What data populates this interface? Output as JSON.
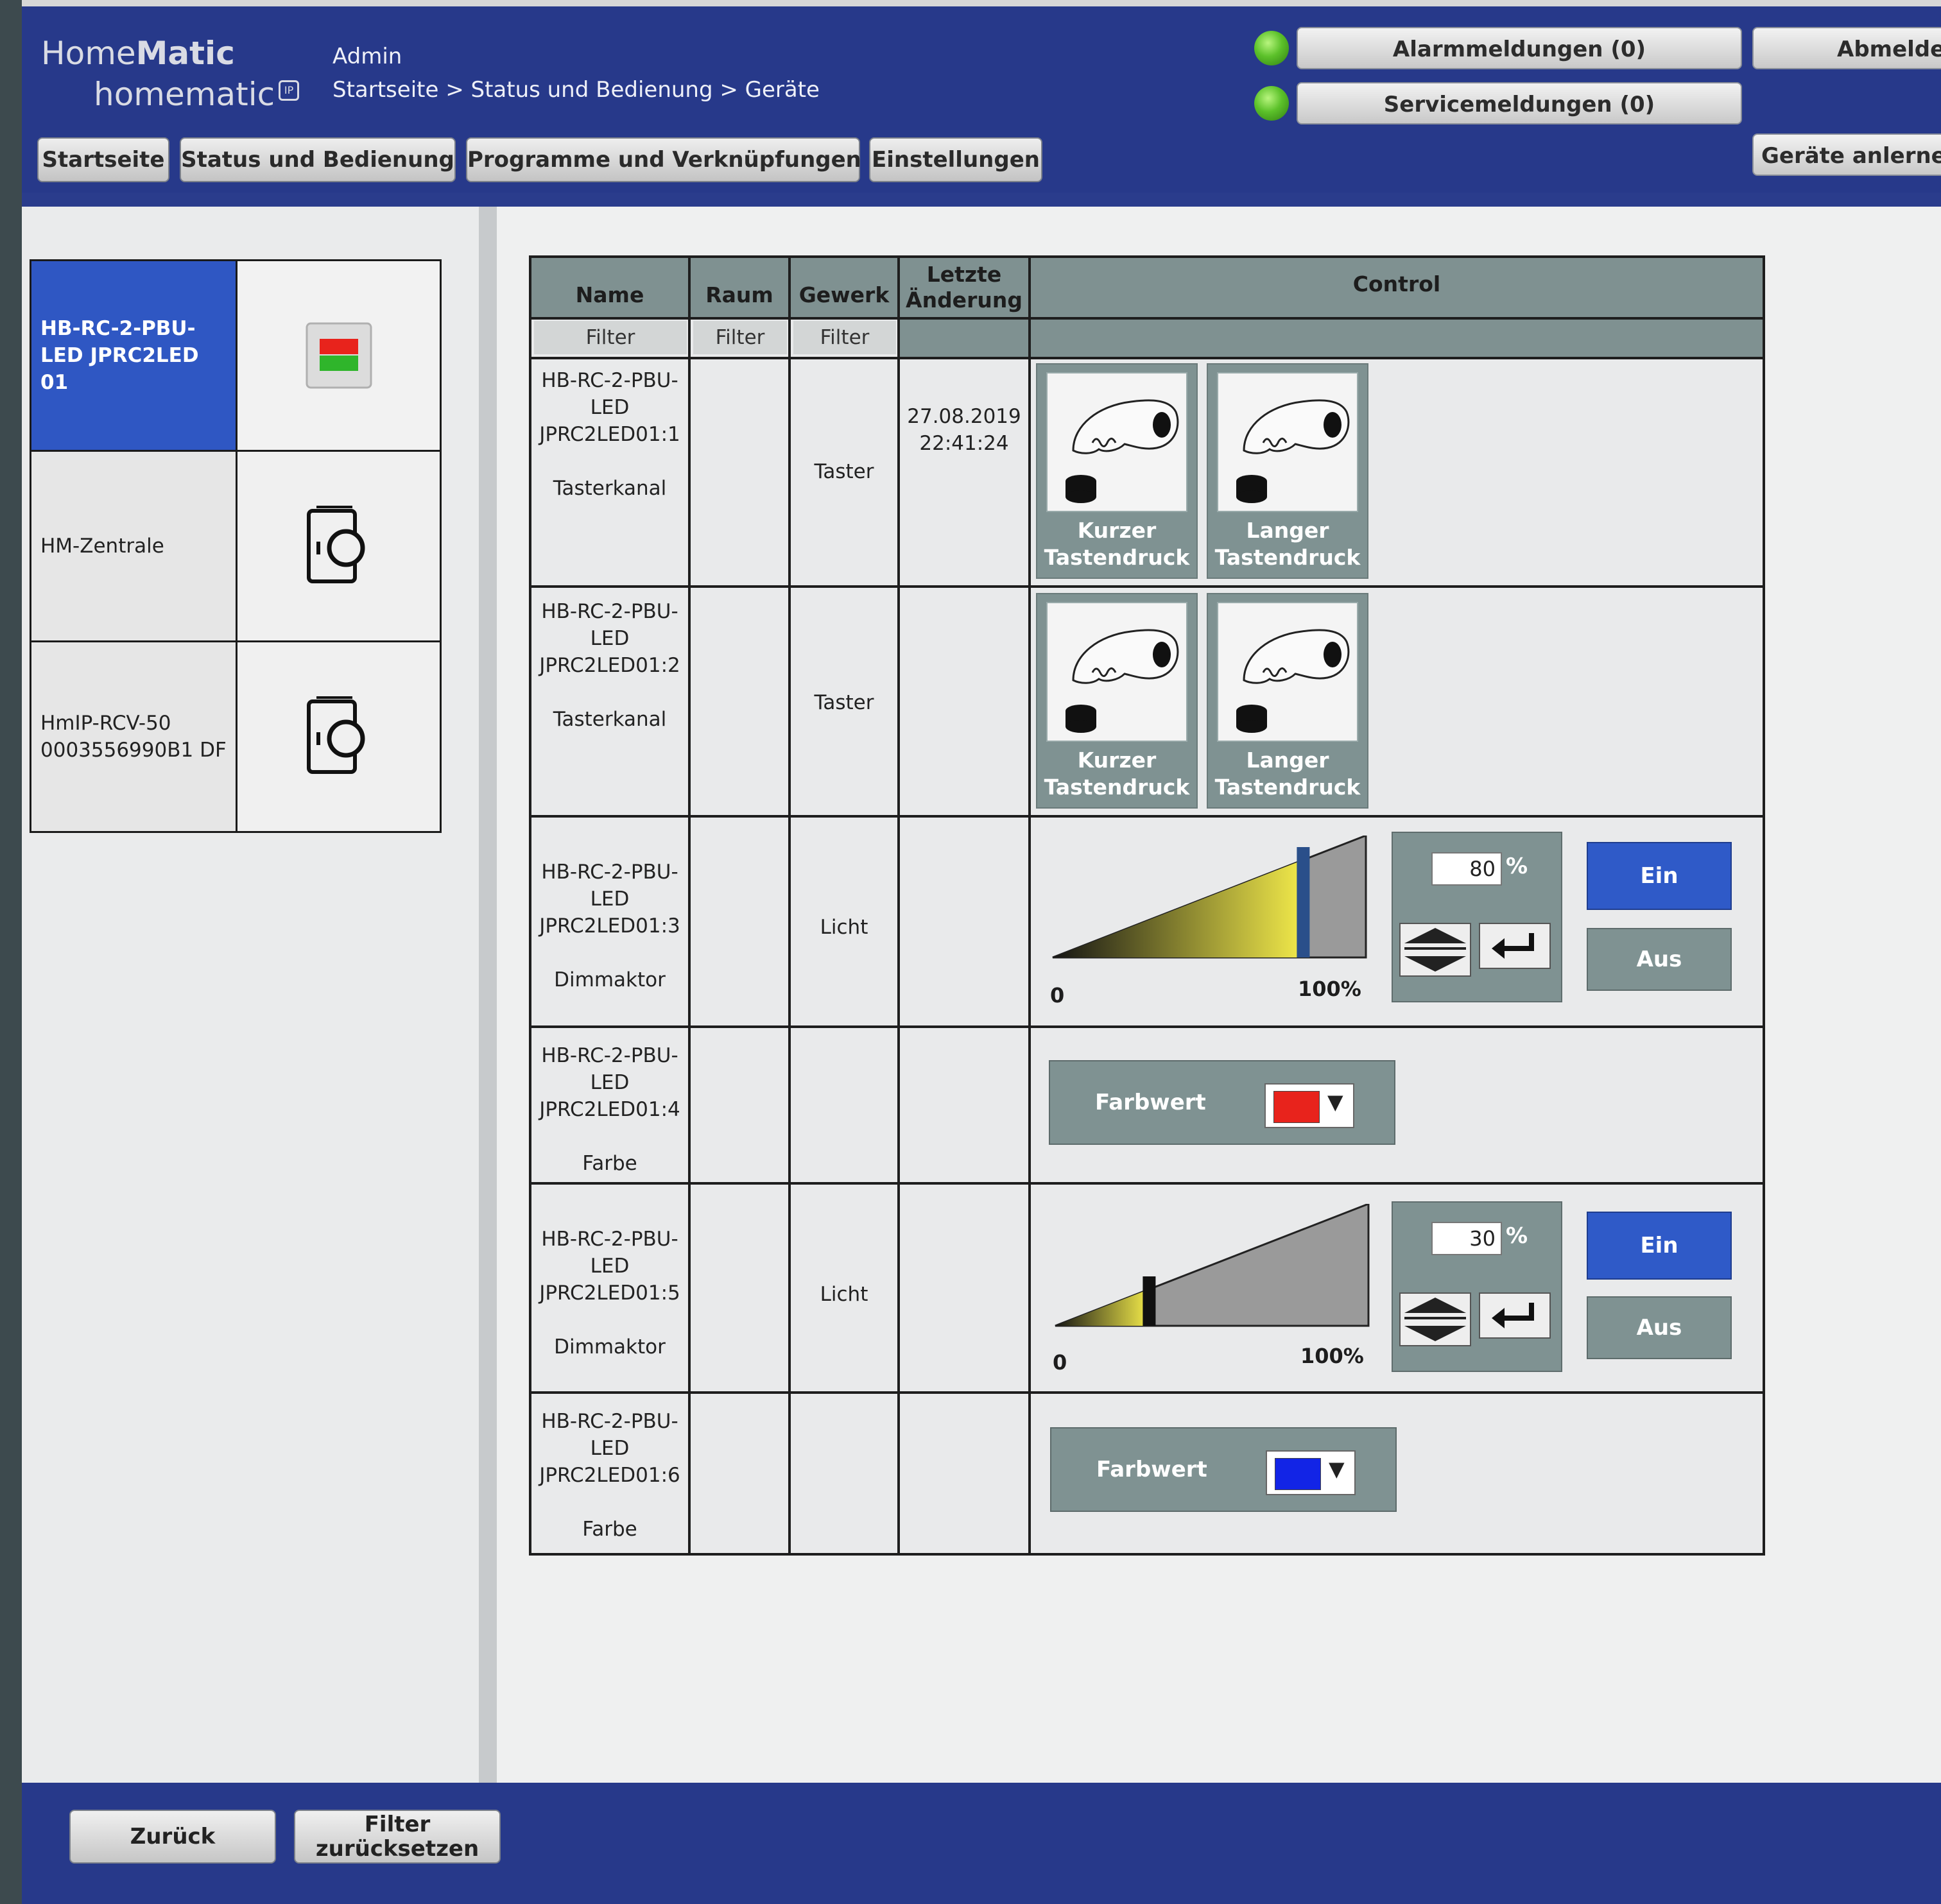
{
  "header": {
    "logo_line1_a": "Home",
    "logo_line1_b": "Matic",
    "logo_line2": "homematic",
    "logo_reg": "IP",
    "user": "Admin",
    "breadcrumb": "Startseite > Status und Bedienung > Geräte",
    "alarm_button": "Alarmmeldungen (0)",
    "service_button": "Servicemeldungen (0)",
    "logout_button": "Abmelden",
    "learn_button": "Geräte anlernen",
    "status_color": "#5cc12a"
  },
  "nav": {
    "tabs": [
      "Startseite",
      "Status und Bedienung",
      "Programme und Verknüpfungen",
      "Einstellungen"
    ]
  },
  "devices": [
    {
      "name": "HB-RC-2-PBU-LED JPRC2LED 01",
      "icon": "status-led-icon",
      "selected": true
    },
    {
      "name": "HM-Zentrale",
      "icon": "device-central-icon",
      "selected": false
    },
    {
      "name": "HmIP-RCV-50 0003556990B1 DF",
      "icon": "device-central-icon",
      "selected": false
    }
  ],
  "table": {
    "headers": {
      "name": "Name",
      "raum": "Raum",
      "gewerk": "Gewerk",
      "letzte": "Letzte Änderung",
      "control": "Control"
    },
    "filter_label": "Filter",
    "rows": [
      {
        "name": "HB-RC-2-PBU-LED JPRC2LED01:1",
        "type": "Tasterkanal",
        "gewerk": "Taster",
        "date": "27.08.2019",
        "time": "22:41:24",
        "short": "Kurzer Tastendruck",
        "long": "Langer Tastendruck"
      },
      {
        "name": "HB-RC-2-PBU-LED JPRC2LED01:2",
        "type": "Tasterkanal",
        "gewerk": "Taster",
        "date": "",
        "time": "",
        "short": "Kurzer Tastendruck",
        "long": "Langer Tastendruck"
      },
      {
        "name": "HB-RC-2-PBU-LED JPRC2LED01:3",
        "type": "Dimmaktor",
        "gewerk": "Licht",
        "level": 80,
        "level_text": "80",
        "min": "0",
        "max": "100%",
        "on": "Ein",
        "off": "Aus"
      },
      {
        "name": "HB-RC-2-PBU-LED JPRC2LED01:4",
        "type": "Farbe",
        "gewerk": "",
        "farb_label": "Farbwert",
        "color": "#e8231c"
      },
      {
        "name": "HB-RC-2-PBU-LED JPRC2LED01:5",
        "type": "Dimmaktor",
        "gewerk": "Licht",
        "level": 30,
        "level_text": "30",
        "min": "0",
        "max": "100%",
        "on": "Ein",
        "off": "Aus"
      },
      {
        "name": "HB-RC-2-PBU-LED JPRC2LED01:6",
        "type": "Farbe",
        "gewerk": "",
        "farb_label": "Farbwert",
        "color": "#1224e6"
      }
    ],
    "percent_sign": "%"
  },
  "footer": {
    "back": "Zurück",
    "reset_line1": "Filter",
    "reset_line2": "zurücksetzen"
  }
}
